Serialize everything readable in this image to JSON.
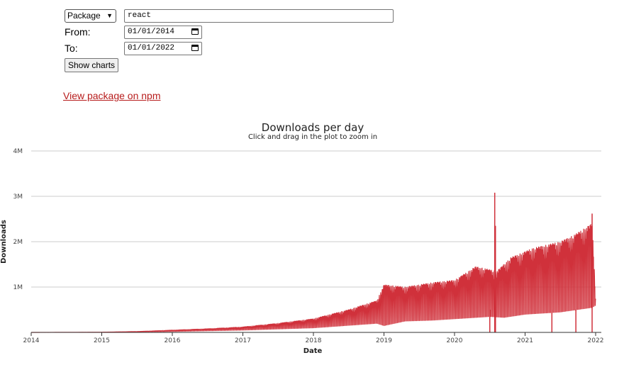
{
  "form": {
    "package_select": "Package",
    "package_value": "react",
    "from_label": "From:",
    "from_value": "01/01/2014",
    "to_label": "To:",
    "to_value": "01/01/2022",
    "show_button": "Show charts"
  },
  "link_text": "View package on npm",
  "colors": {
    "line": "#d0313b",
    "link": "#b71c1c",
    "grid": "#cccccc"
  },
  "chart_data": {
    "type": "line",
    "title": "Downloads per day",
    "subtitle": "Click and drag in the plot to zoom in",
    "xlabel": "Date",
    "ylabel": "Downloads",
    "xlim": [
      2014,
      2022
    ],
    "ylim": [
      0,
      4000000
    ],
    "x_ticks": [
      "2014",
      "2015",
      "2016",
      "2017",
      "2018",
      "2019",
      "2020",
      "2021",
      "2022"
    ],
    "y_ticks": [
      "1M",
      "2M",
      "3M",
      "4M"
    ],
    "grid": true,
    "series": [
      {
        "peak_envelope": [
          [
            2014.0,
            0
          ],
          [
            2015.0,
            5000
          ],
          [
            2015.5,
            20000
          ],
          [
            2016.0,
            50000
          ],
          [
            2016.5,
            80000
          ],
          [
            2017.0,
            120000
          ],
          [
            2017.5,
            200000
          ],
          [
            2018.0,
            300000
          ],
          [
            2018.5,
            500000
          ],
          [
            2018.9,
            700000
          ],
          [
            2019.0,
            1050000
          ],
          [
            2019.3,
            1000000
          ],
          [
            2019.7,
            1100000
          ],
          [
            2020.0,
            1150000
          ],
          [
            2020.3,
            1450000
          ],
          [
            2020.6,
            1350000
          ],
          [
            2020.8,
            1650000
          ],
          [
            2021.0,
            1780000
          ],
          [
            2021.1,
            1850000
          ],
          [
            2021.5,
            2000000
          ],
          [
            2021.7,
            2150000
          ],
          [
            2021.95,
            2400000
          ],
          [
            2022.0,
            800000
          ]
        ],
        "weekend_envelope": [
          [
            2014.0,
            0
          ],
          [
            2015.0,
            2000
          ],
          [
            2016.0,
            20000
          ],
          [
            2017.0,
            50000
          ],
          [
            2018.0,
            100000
          ],
          [
            2018.9,
            200000
          ],
          [
            2019.0,
            150000
          ],
          [
            2019.3,
            250000
          ],
          [
            2019.7,
            270000
          ],
          [
            2020.0,
            300000
          ],
          [
            2020.5,
            350000
          ],
          [
            2020.7,
            330000
          ],
          [
            2021.0,
            400000
          ],
          [
            2021.5,
            450000
          ],
          [
            2021.95,
            550000
          ],
          [
            2022.0,
            600000
          ]
        ],
        "spikes": [
          [
            2020.57,
            3080000
          ],
          [
            2020.58,
            2350000
          ],
          [
            2021.95,
            2620000
          ]
        ],
        "dips": [
          2020.5,
          2020.58,
          2021.38,
          2021.72
        ]
      }
    ]
  }
}
